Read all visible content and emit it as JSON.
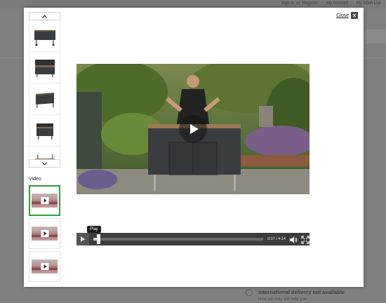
{
  "background": {
    "top_links": [
      "Sign In",
      "or",
      "Register",
      "My Account",
      "My Wish List"
    ],
    "delivery_title": "International delivery not available",
    "delivery_sub": "How we may still help you"
  },
  "modal": {
    "close_label": "Close",
    "video_heading": "Video",
    "thumbnails": [
      {
        "icon": "grill-station-front"
      },
      {
        "icon": "grill-station-open"
      },
      {
        "icon": "grill-station-angle"
      },
      {
        "icon": "grill-station-side"
      },
      {
        "icon": "grill-station-shelf"
      }
    ],
    "video_thumbs": [
      {
        "icon": "video-thumb-1",
        "active": true
      },
      {
        "icon": "video-thumb-2",
        "active": false
      },
      {
        "icon": "video-thumb-3",
        "active": false
      }
    ]
  },
  "player": {
    "tooltip": "Play",
    "time": "0:07 / 4:14",
    "progress_fraction": 0.028,
    "colors": {
      "accent": "#2f9e3a",
      "bar": "#3d3d3d"
    }
  }
}
